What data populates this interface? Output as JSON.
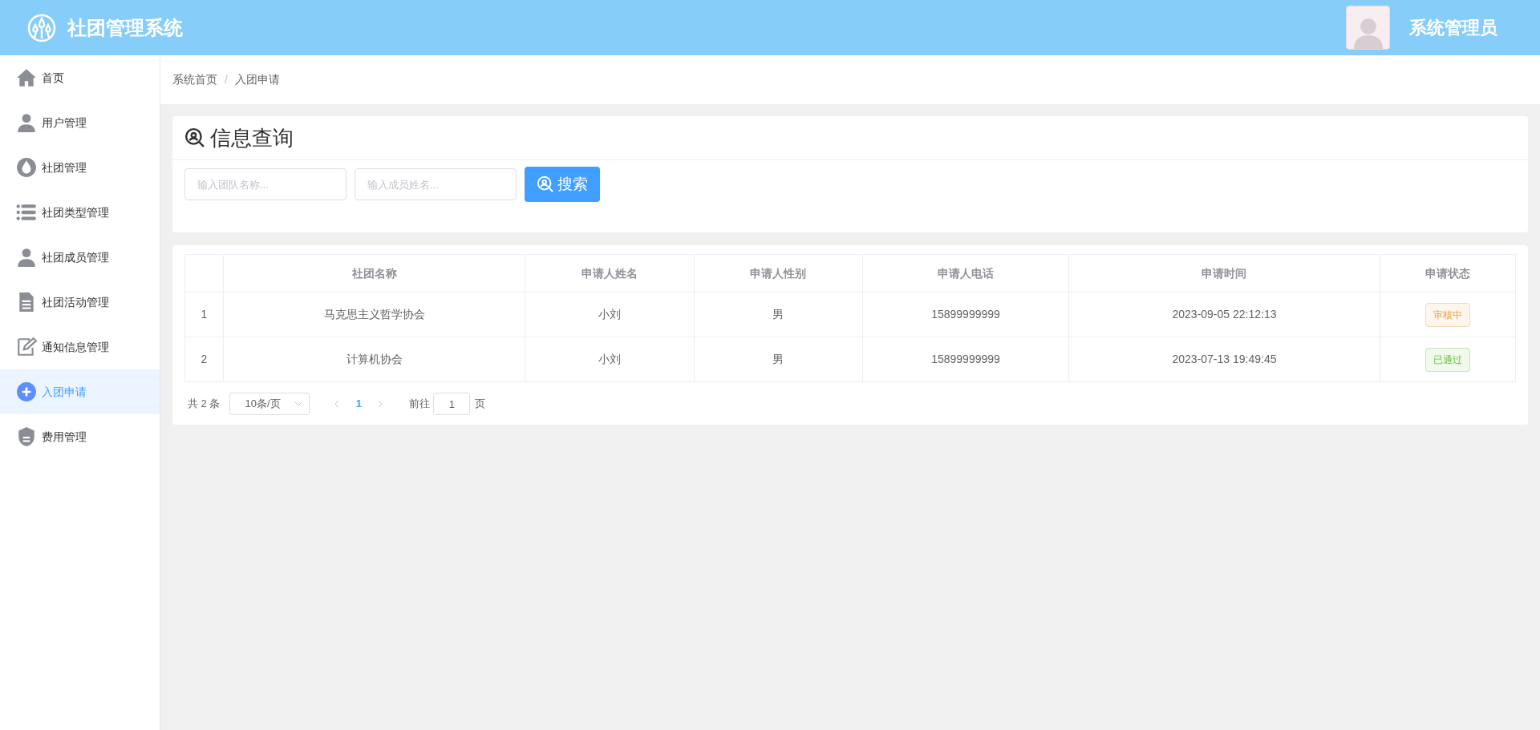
{
  "header": {
    "title": "社团管理系统",
    "user": "系统管理员"
  },
  "sidebar": {
    "items": [
      {
        "label": "首页",
        "selected": false
      },
      {
        "label": "用户管理",
        "selected": false
      },
      {
        "label": "社团管理",
        "selected": false
      },
      {
        "label": "社团类型管理",
        "selected": false
      },
      {
        "label": "社团成员管理",
        "selected": false
      },
      {
        "label": "社团活动管理",
        "selected": false
      },
      {
        "label": "通知信息管理",
        "selected": false
      },
      {
        "label": "入团申请",
        "selected": true
      },
      {
        "label": "费用管理",
        "selected": false
      }
    ]
  },
  "breadcrumb": [
    "系统首页",
    "入团申请"
  ],
  "breadcrumb_separator": "/",
  "search": {
    "title": "信息查询",
    "fields": [
      {
        "placeholder": "输入团队名称..."
      },
      {
        "placeholder": "输入成员姓名..."
      }
    ],
    "button": "搜索"
  },
  "table": {
    "columns": [
      "",
      "社团名称",
      "申请人姓名",
      "申请人性别",
      "申请人电话",
      "申请时间",
      "申请状态"
    ],
    "rows": [
      {
        "index": "1",
        "club": "马克思主义哲学协会",
        "name": "小刘",
        "gender": "男",
        "phone": "15899999999",
        "time": "2023-09-05 22:12:13",
        "status": {
          "text": "审核中",
          "kind": "pending"
        }
      },
      {
        "index": "2",
        "club": "计算机协会",
        "name": "小刘",
        "gender": "男",
        "phone": "15899999999",
        "time": "2023-07-13 19:49:45",
        "status": {
          "text": "已通过",
          "kind": "approved"
        }
      }
    ]
  },
  "pagination": {
    "total": "共 2 条",
    "page_size": "10条/页",
    "pages": [
      {
        "label": "1",
        "selected": true
      }
    ],
    "goto_label": "前往",
    "goto_value": "1",
    "goto_suffix": "页"
  }
}
